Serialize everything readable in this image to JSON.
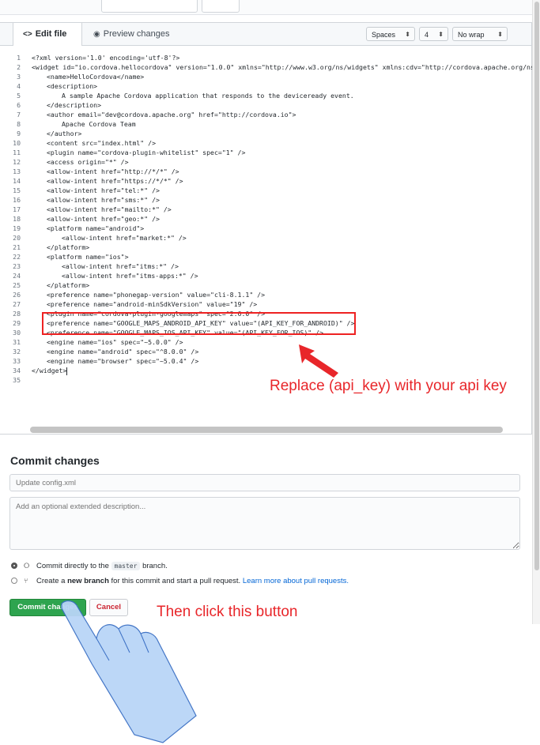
{
  "toolbar": {
    "tab_edit": "Edit file",
    "tab_preview": "Preview changes",
    "indent_mode": "Spaces",
    "indent_size": "4",
    "wrap_mode": "No wrap"
  },
  "code_lines": [
    {
      "n": "1",
      "indent": 0,
      "text": "<?xml version='1.0' encoding='utf-8'?>"
    },
    {
      "n": "2",
      "indent": 0,
      "text": "<widget id=\"io.cordova.hellocordova\" version=\"1.0.0\" xmlns=\"http://www.w3.org/ns/widgets\" xmlns:cdv=\"http://cordova.apache.org/ns"
    },
    {
      "n": "3",
      "indent": 1,
      "text": "<name>HelloCordova</name>"
    },
    {
      "n": "4",
      "indent": 1,
      "text": "<description>"
    },
    {
      "n": "5",
      "indent": 2,
      "text": "A sample Apache Cordova application that responds to the deviceready event."
    },
    {
      "n": "6",
      "indent": 1,
      "text": "</description>"
    },
    {
      "n": "7",
      "indent": 1,
      "text": "<author email=\"dev@cordova.apache.org\" href=\"http://cordova.io\">"
    },
    {
      "n": "8",
      "indent": 2,
      "text": "Apache Cordova Team"
    },
    {
      "n": "9",
      "indent": 1,
      "text": "</author>"
    },
    {
      "n": "10",
      "indent": 1,
      "text": "<content src=\"index.html\" />"
    },
    {
      "n": "11",
      "indent": 1,
      "text": "<plugin name=\"cordova-plugin-whitelist\" spec=\"1\" />"
    },
    {
      "n": "12",
      "indent": 1,
      "text": "<access origin=\"*\" />"
    },
    {
      "n": "13",
      "indent": 1,
      "text": "<allow-intent href=\"http://*/*\" />"
    },
    {
      "n": "14",
      "indent": 1,
      "text": "<allow-intent href=\"https://*/*\" />"
    },
    {
      "n": "15",
      "indent": 1,
      "text": "<allow-intent href=\"tel:*\" />"
    },
    {
      "n": "16",
      "indent": 1,
      "text": "<allow-intent href=\"sms:*\" />"
    },
    {
      "n": "17",
      "indent": 1,
      "text": "<allow-intent href=\"mailto:*\" />"
    },
    {
      "n": "18",
      "indent": 1,
      "text": "<allow-intent href=\"geo:*\" />"
    },
    {
      "n": "19",
      "indent": 1,
      "text": "<platform name=\"android\">"
    },
    {
      "n": "20",
      "indent": 2,
      "text": "<allow-intent href=\"market:*\" />"
    },
    {
      "n": "21",
      "indent": 1,
      "text": "</platform>"
    },
    {
      "n": "22",
      "indent": 1,
      "text": "<platform name=\"ios\">"
    },
    {
      "n": "23",
      "indent": 2,
      "text": "<allow-intent href=\"itms:*\" />"
    },
    {
      "n": "24",
      "indent": 2,
      "text": "<allow-intent href=\"itms-apps:*\" />"
    },
    {
      "n": "25",
      "indent": 1,
      "text": "</platform>"
    },
    {
      "n": "26",
      "indent": 1,
      "text": "<preference name=\"phonegap-version\" value=\"cli-8.1.1\" />"
    },
    {
      "n": "27",
      "indent": 1,
      "text": "<preference name=\"android-minSdkVersion\" value=\"19\" />"
    },
    {
      "n": "28",
      "indent": 1,
      "text": "<plugin name=\"cordova-plugin-googlemaps\" spec=\"2.6.0\" />"
    },
    {
      "n": "29",
      "indent": 1,
      "text": "<preference name=\"GOOGLE_MAPS_ANDROID_API_KEY\" value=\"(API_KEY_FOR_ANDROID)\" />"
    },
    {
      "n": "30",
      "indent": 1,
      "text": "<preference name=\"GOOGLE_MAPS_IOS_API_KEY\" value=\"(API_KEY_FOR_IOS)\" />"
    },
    {
      "n": "31",
      "indent": 1,
      "text": "<engine name=\"ios\" spec=\"~5.0.0\" />"
    },
    {
      "n": "32",
      "indent": 1,
      "text": "<engine name=\"android\" spec=\"^8.0.0\" />"
    },
    {
      "n": "33",
      "indent": 1,
      "text": "<engine name=\"browser\" spec=\"~5.0.4\" />"
    },
    {
      "n": "34",
      "indent": 0,
      "text": "</widget>"
    },
    {
      "n": "35",
      "indent": 0,
      "text": ""
    }
  ],
  "annotations": {
    "replace_note": "Replace (api_key) with your api key",
    "click_note": "Then click this button",
    "color": "#e8262a"
  },
  "commit": {
    "title": "Commit changes",
    "summary_placeholder": "Update config.xml",
    "description_placeholder": "Add an optional extended description...",
    "option_direct_prefix": "Commit directly to the",
    "option_direct_branch": "master",
    "option_direct_suffix": "branch.",
    "option_new_prefix": "Create a",
    "option_new_bold": "new branch",
    "option_new_suffix": "for this commit and start a pull request.",
    "option_new_link": "Learn more about pull requests.",
    "commit_button": "Commit changes",
    "cancel_button": "Cancel"
  },
  "colors": {
    "commit_green": "#2ea44f",
    "cancel_red": "#cb2431",
    "link_blue": "#0366d6"
  }
}
